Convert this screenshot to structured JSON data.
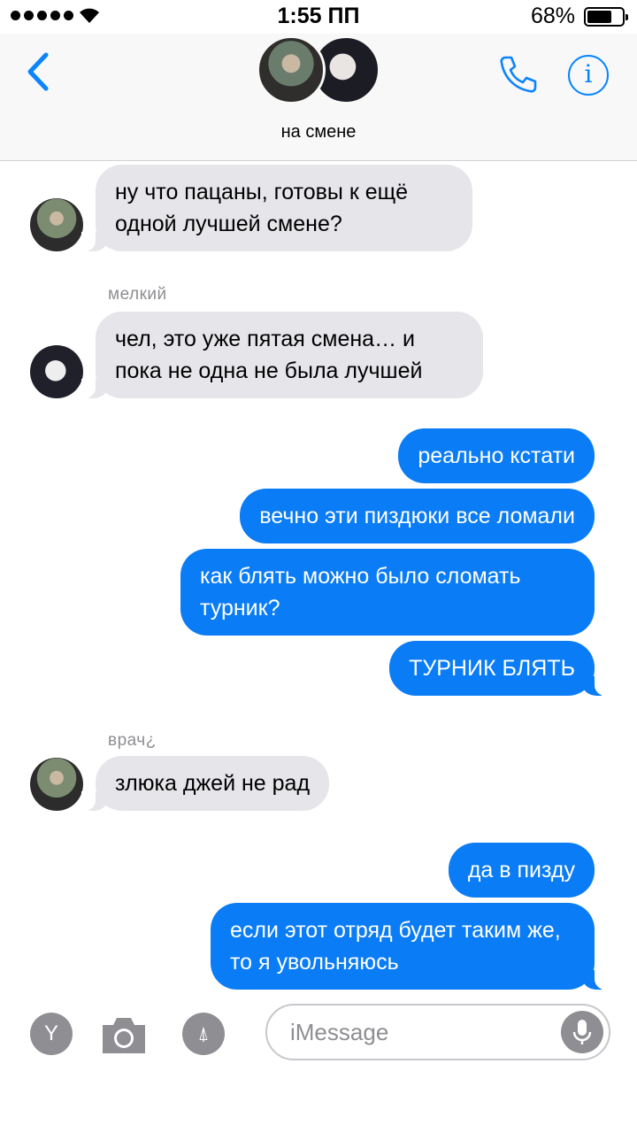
{
  "status": {
    "time": "1:55 ПП",
    "battery": "68%"
  },
  "header": {
    "title": "на смене"
  },
  "messages": {
    "m1": "ну что пацаны, готовы к ещё одной лучшей смене?",
    "sender2": "мелкий",
    "m2": "чел, это уже пятая смена… и пока не одна не была лучшей",
    "m3": "реально кстати",
    "m4": "вечно эти пиздюки все ломали",
    "m5": "как блять можно было сломать турник?",
    "m6": "ТУРНИК БЛЯТЬ",
    "sender3": "врач¿",
    "m7": "злюка джей не рад",
    "m8": "да в пизду",
    "m9": "если этот отряд будет таким же, то я увольняюсь"
  },
  "input": {
    "placeholder": "iMessage",
    "app_icon": "Y"
  },
  "colors": {
    "accent": "#0a84ff",
    "outgoing": "#0a7cf5",
    "incoming": "#e5e5ea"
  }
}
